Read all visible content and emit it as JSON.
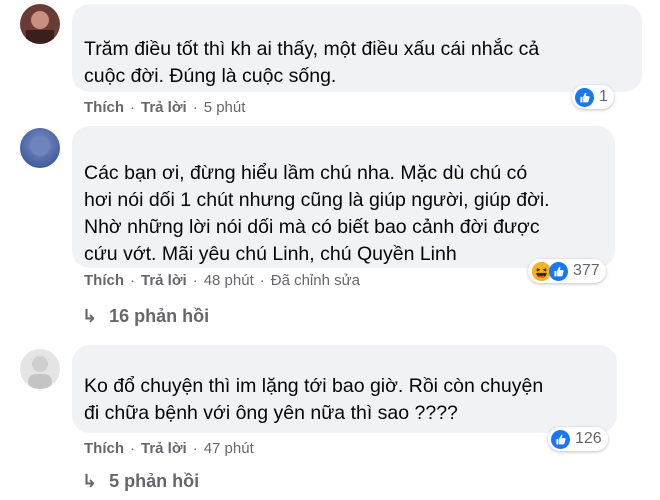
{
  "comments": [
    {
      "text": "Trăm điều tốt thì kh ai thấy, một điều xấu cái nhắc cả\ncuộc đời. Đúng là cuộc sống.",
      "like_label": "Thích",
      "reply_label": "Trả lời",
      "time": "5 phút",
      "reaction_count": "1"
    },
    {
      "text": "Các bạn ơi, đừng hiểu lầm chú nha. Mặc dù chú có\nhơi nói dối 1 chút nhưng cũng là giúp người, giúp đời.\nNhờ những lời nói dối mà có biết bao cảnh đời được\ncứu vớt. Mãi yêu chú Linh, chú Quyền Linh",
      "like_label": "Thích",
      "reply_label": "Trả lời",
      "time": "48 phút",
      "edited": "Đã chỉnh sửa",
      "reaction_count": "377",
      "replies": "16 phản hồi"
    },
    {
      "text": "Ko đổ chuyện thì im lặng tới bao giờ. Rồi còn chuyện\nđi chữa bệnh với ông yên nữa thì sao ????",
      "like_label": "Thích",
      "reply_label": "Trả lời",
      "time": "47 phút",
      "reaction_count": "126",
      "replies": "5 phản hồi"
    }
  ],
  "dot": "·",
  "colors": {
    "bubble": "#f0f2f5",
    "like": "#1877f2",
    "muted": "#65676b"
  }
}
